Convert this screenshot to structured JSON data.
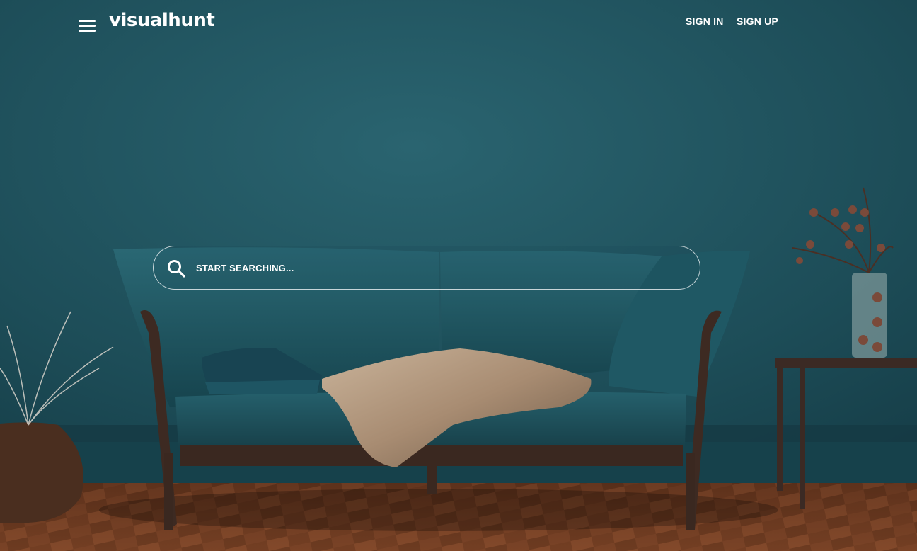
{
  "header": {
    "logo_text": "visualhunt",
    "menu_icon": "hamburger-menu-icon",
    "nav": {
      "sign_in": "SIGN IN",
      "sign_up": "SIGN UP"
    }
  },
  "search": {
    "placeholder": "START SEARCHING...",
    "value": "",
    "icon": "search-icon"
  },
  "hero_image": {
    "subject": "teal sofa with cushions and fur throw against teal wall",
    "wall_color": "#1c4a55",
    "floor_color": "#6b3a22"
  },
  "colors": {
    "text": "#ffffff",
    "search_border": "rgba(255,255,255,0.75)"
  }
}
